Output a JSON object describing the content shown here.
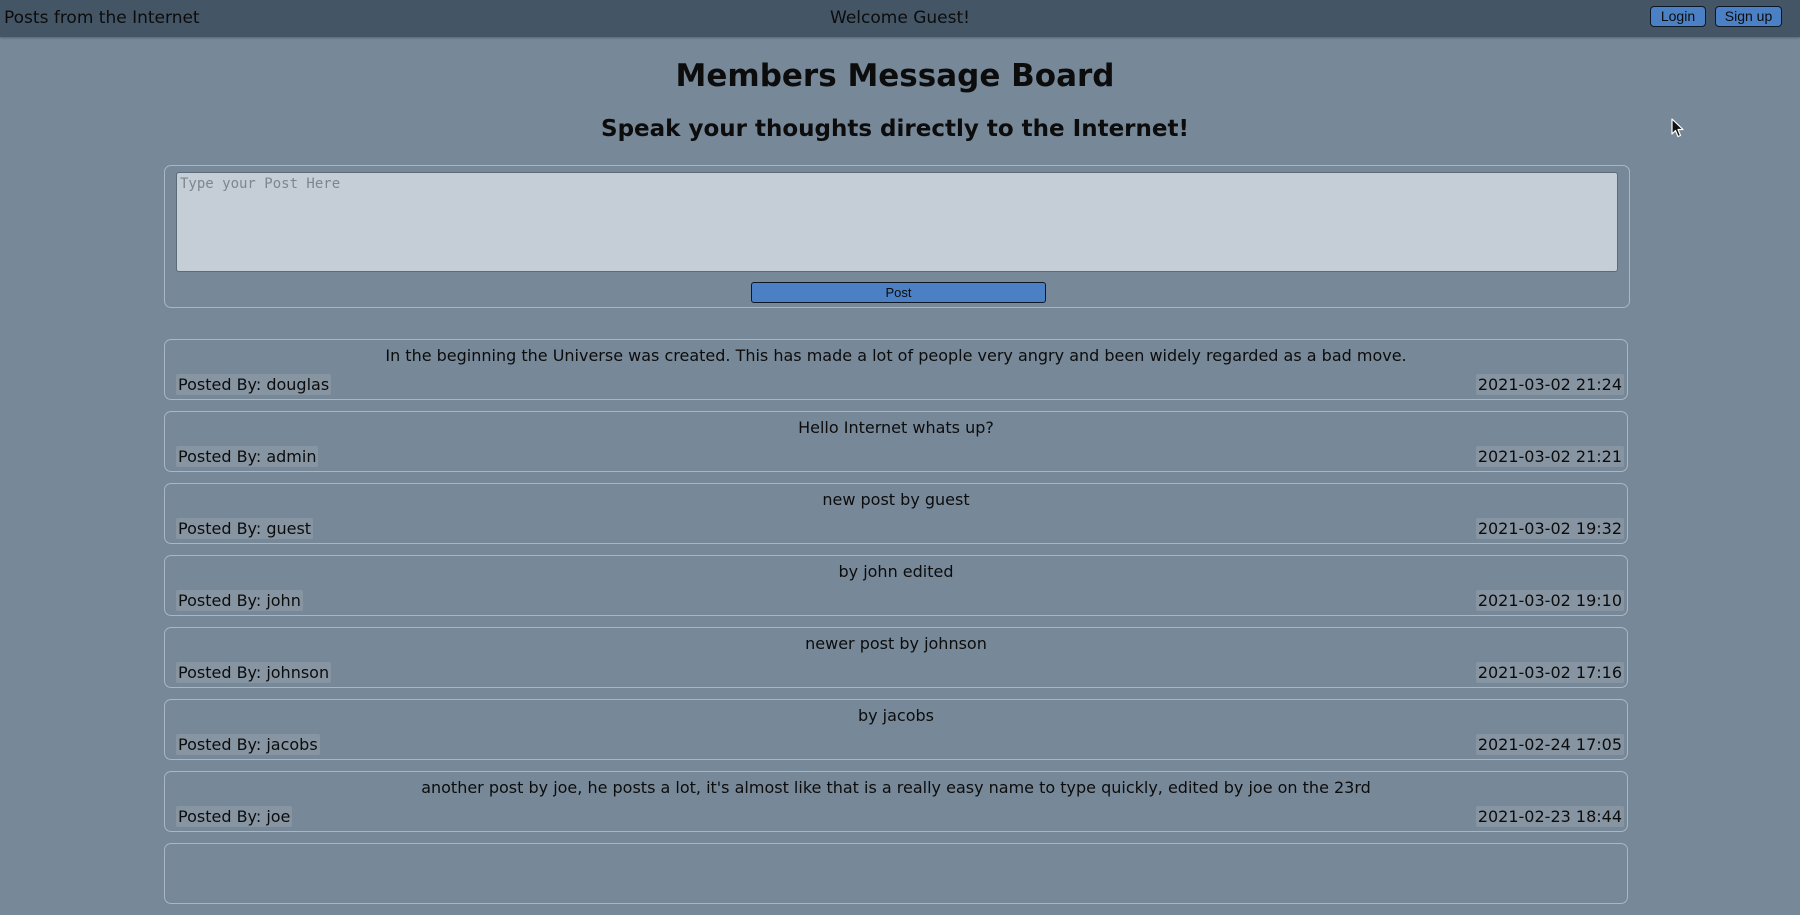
{
  "navbar": {
    "brand": "Posts from the Internet",
    "welcome": "Welcome Guest!",
    "login_label": "Login",
    "signup_label": "Sign up"
  },
  "board": {
    "title": "Members Message Board",
    "subtitle": "Speak your thoughts directly to the Internet!"
  },
  "compose": {
    "placeholder": "Type your Post Here",
    "post_label": "Post"
  },
  "posts": [
    {
      "content": "In the beginning the Universe was created. This has made a lot of people very angry and been widely regarded as a bad move.",
      "author": "Posted By: douglas",
      "date": "2021-03-02 21:24"
    },
    {
      "content": "Hello Internet whats up?",
      "author": "Posted By: admin",
      "date": "2021-03-02 21:21"
    },
    {
      "content": "new post by guest",
      "author": "Posted By: guest",
      "date": "2021-03-02 19:32"
    },
    {
      "content": "by john edited",
      "author": "Posted By: john",
      "date": "2021-03-02 19:10"
    },
    {
      "content": "newer post by johnson",
      "author": "Posted By: johnson",
      "date": "2021-03-02 17:16"
    },
    {
      "content": "by jacobs",
      "author": "Posted By: jacobs",
      "date": "2021-02-24 17:05"
    },
    {
      "content": "another post by joe, he posts a lot, it's almost like that is a really easy name to type quickly, edited by joe on the 23rd",
      "author": "Posted By: joe",
      "date": "2021-02-23 18:44"
    },
    {
      "content": "",
      "author": "",
      "date": ""
    }
  ]
}
